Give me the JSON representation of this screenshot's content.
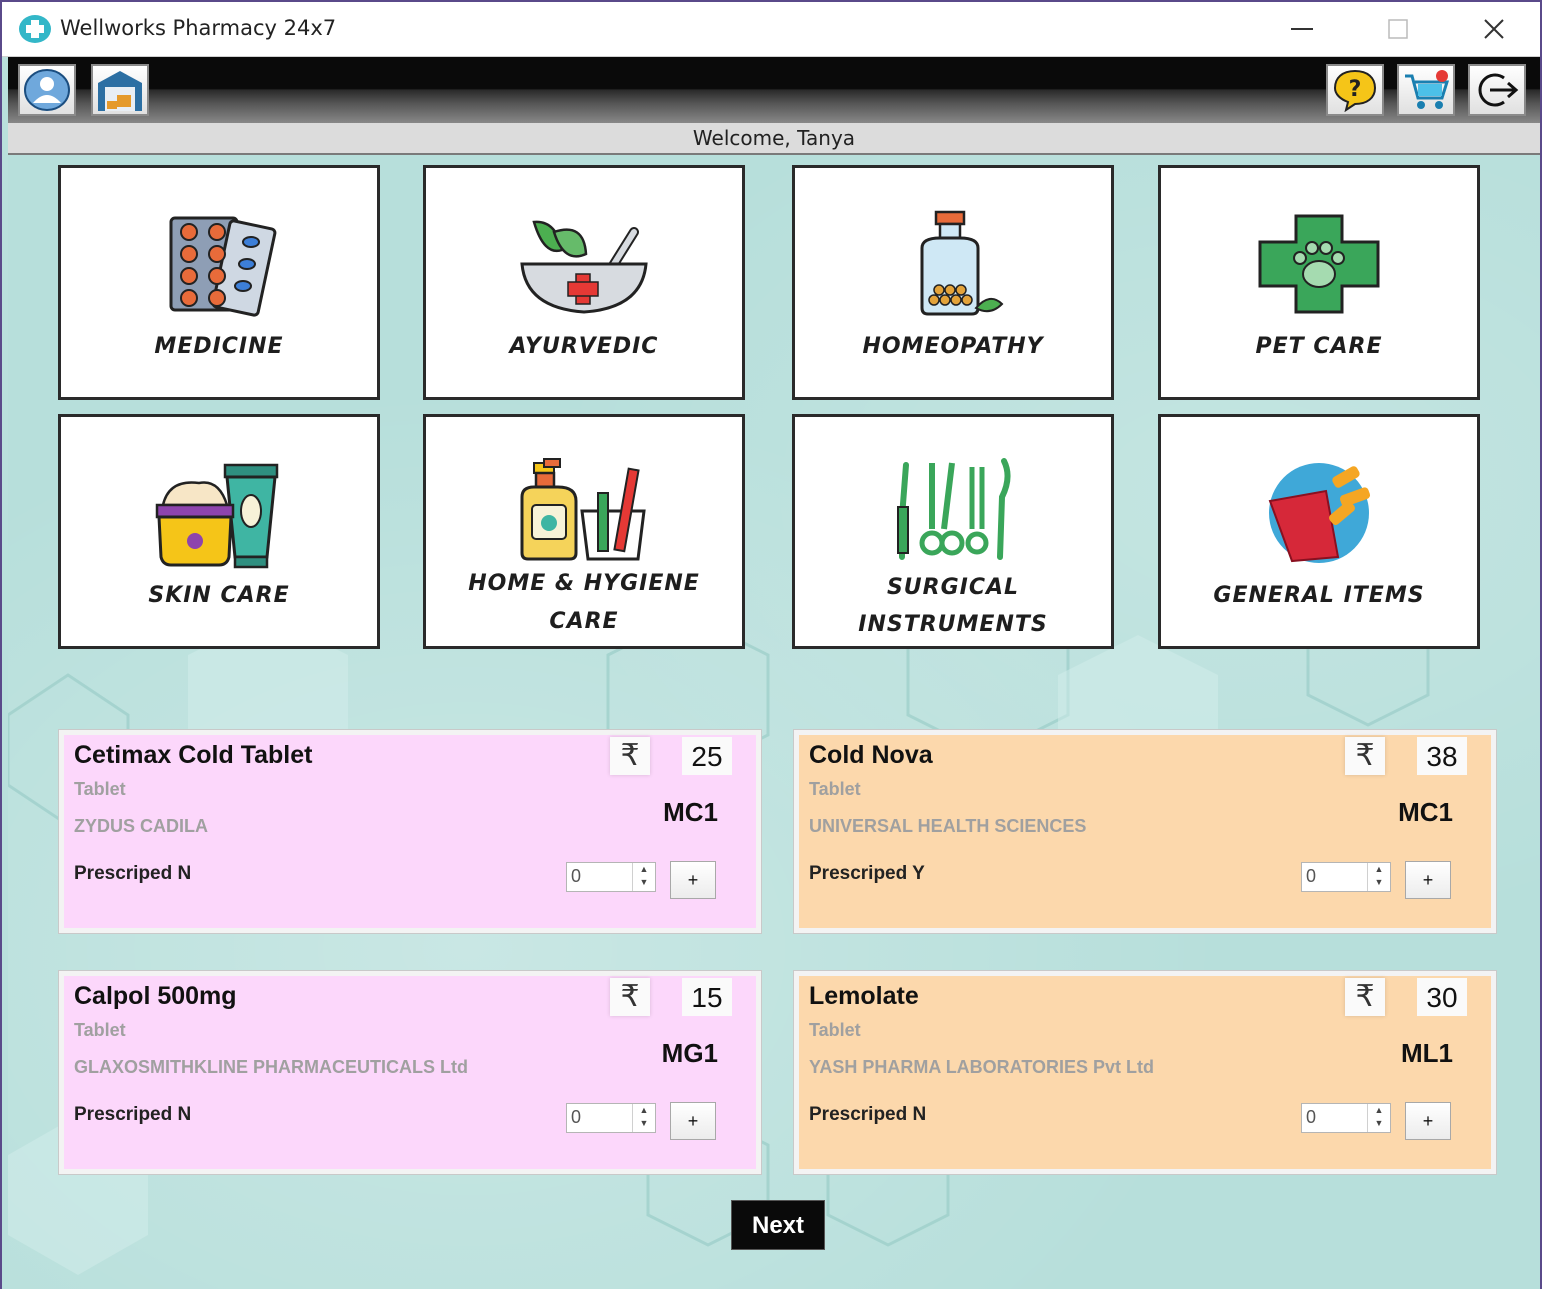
{
  "window": {
    "title": "Wellworks Pharmacy 24x7",
    "controls": {
      "minimize": "—",
      "maximize": "☐",
      "close": "✕"
    }
  },
  "toolbar": {
    "left_buttons": [
      "profile-icon",
      "warehouse-icon"
    ],
    "right_buttons": [
      "help-icon",
      "cart-icon",
      "logout-icon"
    ]
  },
  "welcome": "Welcome, Tanya",
  "categories": [
    {
      "label": "MEDICINE",
      "icon": "pills-icon"
    },
    {
      "label": "AYURVEDIC",
      "icon": "mortar-pestle-icon"
    },
    {
      "label": "HOMEOPATHY",
      "icon": "bottle-icon"
    },
    {
      "label": "PET CARE",
      "icon": "paw-cross-icon"
    },
    {
      "label": "SKIN CARE",
      "icon": "cream-icon"
    },
    {
      "label_1": "HOME & HYGIENE",
      "label_2": "CARE",
      "icon": "soap-icon"
    },
    {
      "label_1": "SURGICAL",
      "label_2": "INSTRUMENTS",
      "icon": "surgical-tools-icon"
    },
    {
      "label": "GENERAL ITEMS",
      "icon": "snacks-icon"
    }
  ],
  "products": [
    {
      "name": "Cetimax Cold Tablet",
      "form": "Tablet",
      "manufacturer": "ZYDUS CADILA",
      "price": "25",
      "code": "MC1",
      "prescribed": "Prescriped N",
      "qty": "0",
      "currency": "₹",
      "add": "+"
    },
    {
      "name": "Cold Nova",
      "form": "Tablet",
      "manufacturer": "UNIVERSAL HEALTH SCIENCES",
      "price": "38",
      "code": "MC1",
      "prescribed": "Prescriped Y",
      "qty": "0",
      "currency": "₹",
      "add": "+"
    },
    {
      "name": "Calpol 500mg",
      "form": "Tablet",
      "manufacturer": "GLAXOSMITHKLINE PHARMACEUTICALS Ltd",
      "price": "15",
      "code": "MG1",
      "prescribed": "Prescriped N",
      "qty": "0",
      "currency": "₹",
      "add": "+"
    },
    {
      "name": "Lemolate",
      "form": "Tablet",
      "manufacturer": "YASH PHARMA LABORATORIES Pvt Ltd",
      "price": "30",
      "code": "ML1",
      "prescribed": "Prescriped N",
      "qty": "0",
      "currency": "₹",
      "add": "+"
    }
  ],
  "next": "Next",
  "colors": {
    "pink_card": "#fcd7fb",
    "peach_card": "#fcd8ac",
    "background": "#b7dfdb"
  }
}
